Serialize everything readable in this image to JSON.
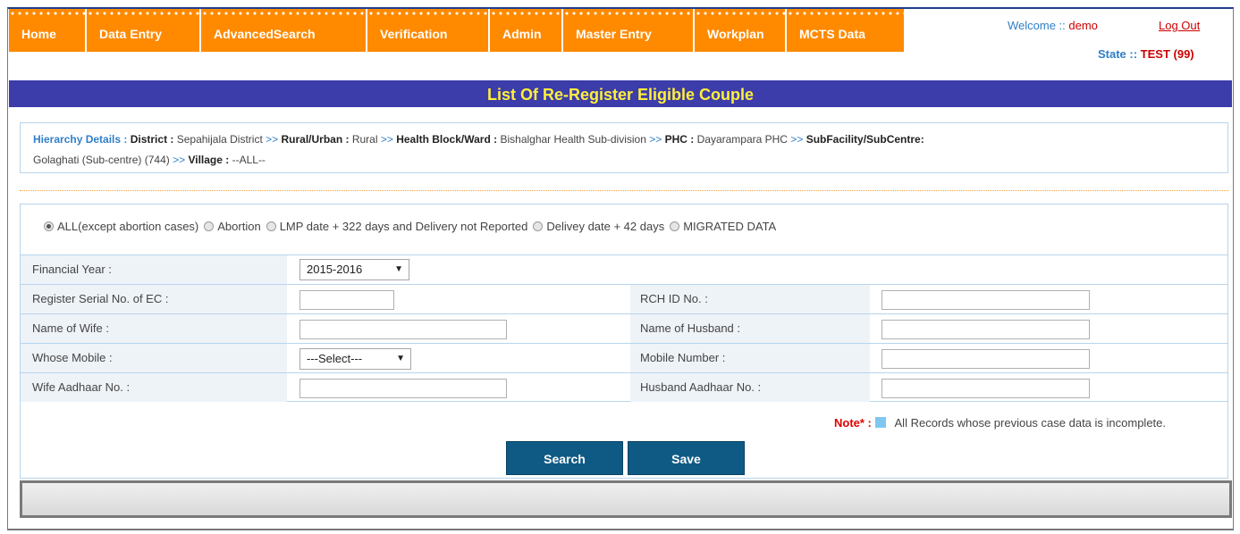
{
  "menu": [
    "Home",
    "Data Entry",
    "AdvancedSearch",
    "Verification",
    "Admin",
    "Master Entry",
    "Workplan",
    "MCTS Data"
  ],
  "header": {
    "welcome_label": "Welcome :: ",
    "user": "demo",
    "logout": "Log Out",
    "state_label": "State :: ",
    "state_value": "TEST (99)"
  },
  "title": "List Of Re-Register Eligible Couple",
  "hierarchy": {
    "label": "Hierarchy Details : ",
    "district_label": "District : ",
    "district": "Sepahijala District",
    "rural_label": "Rural/Urban : ",
    "rural": "Rural",
    "block_label": "Health Block/Ward : ",
    "block": "Bishalghar Health Sub-division",
    "phc_label": "PHC : ",
    "phc": "Dayarampara PHC",
    "sub_label": "SubFacility/SubCentre:",
    "sub": "Golaghati (Sub-centre) (744)",
    "village_label": "Village : ",
    "village": "--ALL--",
    "sep": ">>"
  },
  "radios": [
    {
      "label": "ALL(except abortion cases)",
      "checked": true
    },
    {
      "label": "Abortion",
      "checked": false
    },
    {
      "label": "LMP date + 322 days and Delivery not Reported",
      "checked": false
    },
    {
      "label": "Delivey date + 42 days",
      "checked": false
    },
    {
      "label": "MIGRATED DATA",
      "checked": false
    }
  ],
  "form": {
    "financial_year_label": "Financial Year :",
    "financial_year_value": "2015-2016",
    "serial_label": "Register Serial No. of EC :",
    "rch_label": "RCH ID No. :",
    "wife_label": "Name of Wife :",
    "husband_label": "Name of Husband :",
    "whose_mobile_label": "Whose Mobile :",
    "whose_mobile_value": "---Select---",
    "mobile_label": "Mobile Number :",
    "wife_aadhaar_label": "Wife Aadhaar No. :",
    "husband_aadhaar_label": "Husband Aadhaar No. :"
  },
  "note": {
    "label": "Note* :",
    "text": "All Records whose previous case data is incomplete."
  },
  "buttons": {
    "search": "Search",
    "save": "Save"
  },
  "colors": {
    "menu_bg": "#ff8a00",
    "title_bg": "#3c3caa",
    "title_text": "#ffef3b",
    "button_bg": "#0f5a85"
  }
}
